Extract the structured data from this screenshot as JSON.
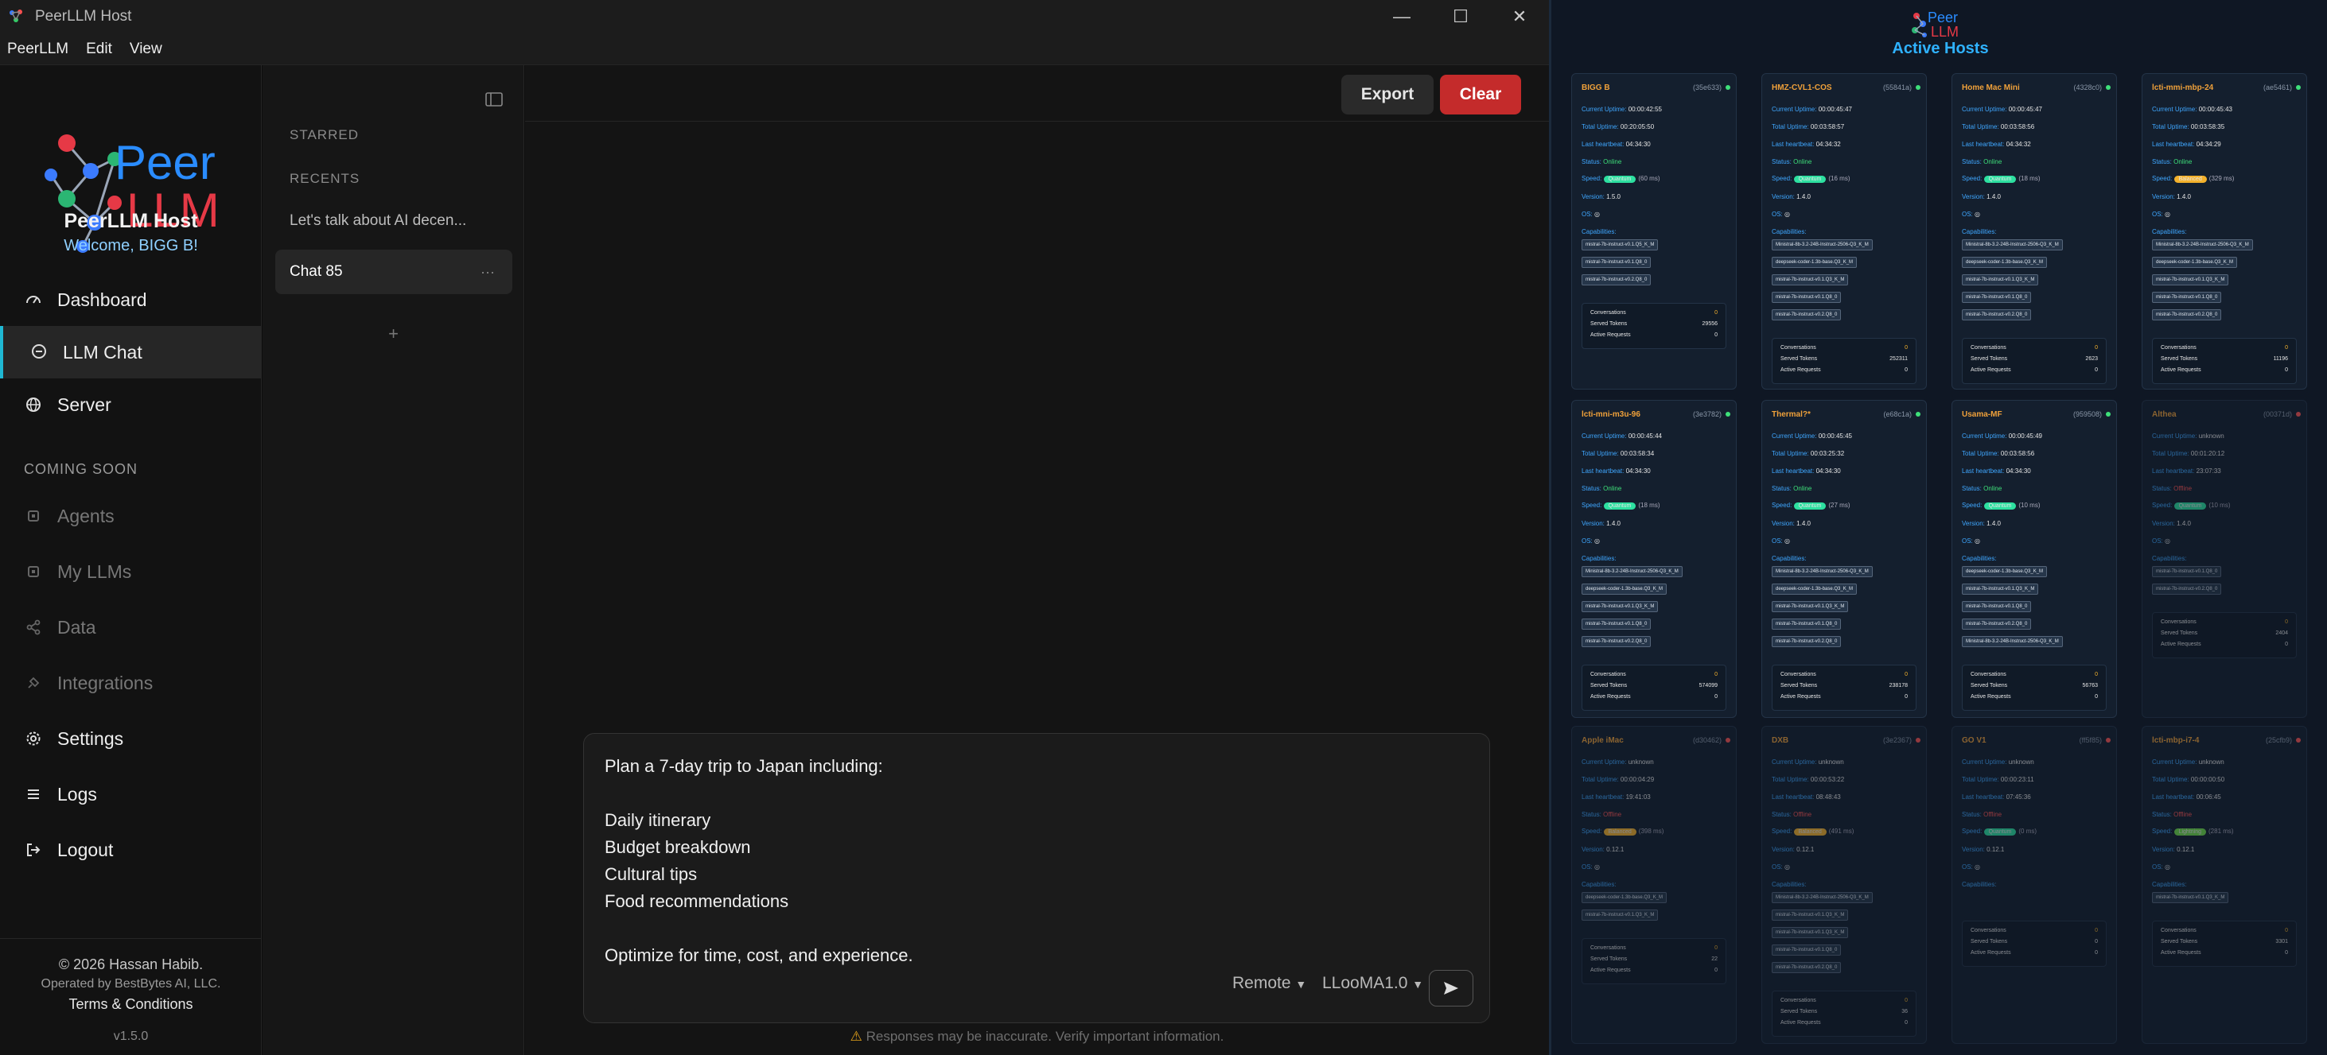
{
  "window": {
    "title": "PeerLLM Host",
    "controls": [
      "minimize",
      "maximize",
      "close"
    ]
  },
  "menu": [
    "PeerLLM",
    "Edit",
    "View"
  ],
  "sidebar": {
    "brand_name": "PeerLLM Host",
    "welcome": "Welcome, BIGG B!",
    "logo_text_top": "Peer",
    "logo_text_bottom": "LLM",
    "nav": [
      {
        "label": "Dashboard",
        "icon": "gauge-icon",
        "active": false,
        "disabled": false
      },
      {
        "label": "LLM Chat",
        "icon": "chat-icon",
        "active": true,
        "disabled": false
      },
      {
        "label": "Server",
        "icon": "globe-icon",
        "active": false,
        "disabled": false
      }
    ],
    "coming_soon_label": "COMING SOON",
    "coming_soon": [
      {
        "label": "Agents",
        "icon": "chip-icon"
      },
      {
        "label": "My LLMs",
        "icon": "chip-icon"
      },
      {
        "label": "Data",
        "icon": "share-icon"
      },
      {
        "label": "Integrations",
        "icon": "plug-icon"
      }
    ],
    "bottom_nav": [
      {
        "label": "Settings",
        "icon": "gear-icon"
      },
      {
        "label": "Logs",
        "icon": "list-icon"
      },
      {
        "label": "Logout",
        "icon": "logout-icon"
      }
    ],
    "footer": {
      "copyright": "© 2026 Hassan Habib.",
      "operated": "Operated by BestBytes AI, LLC.",
      "terms": "Terms & Conditions",
      "version": "v1.5.0"
    }
  },
  "chat_list": {
    "starred_label": "STARRED",
    "recents_label": "RECENTS",
    "items": [
      {
        "title": "Let's talk about AI decen...",
        "selected": false
      },
      {
        "title": "Chat 85",
        "selected": true,
        "more": "···"
      }
    ],
    "add_label": "+"
  },
  "main": {
    "export_label": "Export",
    "clear_label": "Clear",
    "prompt_lines": [
      "Plan a 7-day trip to Japan including:",
      "",
      "Daily itinerary",
      "Budget breakdown",
      "Cultural tips",
      "Food recommendations",
      "",
      "Optimize for time, cost, and experience."
    ],
    "mode_select": "Remote",
    "model_select": "LLooMA1.0",
    "disclaimer": "Responses may be inaccurate. Verify important information."
  },
  "hosts_panel": {
    "title": "Active Hosts",
    "labels": {
      "current": "Current Uptime:",
      "total": "Total Uptime:",
      "heartbeat": "Last heartbeat:",
      "status": "Status:",
      "speed": "Speed:",
      "version": "Version:",
      "os": "OS:",
      "capabilities": "Capabilities:",
      "conversations": "Conversations",
      "served": "Served Tokens",
      "active": "Active Requests"
    },
    "hosts": [
      {
        "name": "BIGG B",
        "id": "(35e633)",
        "online": true,
        "current": "00:00:42:55",
        "total": "00:20:05:50",
        "heartbeat": "04:34:30",
        "status": "Online",
        "speed": "Quantum",
        "latency": "(60 ms)",
        "version": "1.5.0",
        "caps": [
          "mistral-7b-instruct-v0.1.Q5_K_M",
          "mistral-7b-instruct-v0.1.Q8_0",
          "mistral-7b-instruct-v0.2.Q8_0"
        ],
        "conversations": "0",
        "served": "29556",
        "active_req": "0"
      },
      {
        "name": "HMZ-CVL1-COS",
        "id": "(55841a)",
        "online": true,
        "current": "00:00:45:47",
        "total": "00:03:58:57",
        "heartbeat": "04:34:32",
        "status": "Online",
        "speed": "Quantum",
        "latency": "(16 ms)",
        "version": "1.4.0",
        "caps": [
          "Ministral-8b-3.2-24B-Instruct-2506-Q3_K_M",
          "deepseek-coder-1.3b-base.Q3_K_M",
          "mistral-7b-instruct-v0.1.Q3_K_M",
          "mistral-7b-instruct-v0.1.Q8_0",
          "mistral-7b-instruct-v0.2.Q8_0"
        ],
        "conversations": "0",
        "served": "252311",
        "active_req": "0"
      },
      {
        "name": "Home Mac Mini",
        "id": "(4328c0)",
        "online": true,
        "current": "00:00:45:47",
        "total": "00:03:58:56",
        "heartbeat": "04:34:32",
        "status": "Online",
        "speed": "Quantum",
        "latency": "(18 ms)",
        "version": "1.4.0",
        "caps": [
          "Ministral-8b-3.2-24B-Instruct-2506-Q3_K_M",
          "deepseek-coder-1.3b-base.Q3_K_M",
          "mistral-7b-instruct-v0.1.Q3_K_M",
          "mistral-7b-instruct-v0.1.Q8_0",
          "mistral-7b-instruct-v0.2.Q8_0"
        ],
        "conversations": "0",
        "served": "2623",
        "active_req": "0"
      },
      {
        "name": "lcti-mmi-mbp-24",
        "id": "(ae5461)",
        "online": true,
        "current": "00:00:45:43",
        "total": "00:03:58:35",
        "heartbeat": "04:34:29",
        "status": "Online",
        "speed": "Balanced",
        "latency": "(329 ms)",
        "version": "1.4.0",
        "caps": [
          "Ministral-8b-3.2-24B-Instruct-2506-Q3_K_M",
          "deepseek-coder-1.3b-base.Q3_K_M",
          "mistral-7b-instruct-v0.1.Q3_K_M",
          "mistral-7b-instruct-v0.1.Q8_0",
          "mistral-7b-instruct-v0.2.Q8_0"
        ],
        "conversations": "0",
        "served": "11196",
        "active_req": "0"
      },
      {
        "name": "lcti-mni-m3u-96",
        "id": "(3e3782)",
        "online": true,
        "current": "00:00:45:44",
        "total": "00:03:58:34",
        "heartbeat": "04:34:30",
        "status": "Online",
        "speed": "Quantum",
        "latency": "(18 ms)",
        "version": "1.4.0",
        "caps": [
          "Ministral-8b-3.2-24B-Instruct-2506-Q3_K_M",
          "deepseek-coder-1.3b-base.Q3_K_M",
          "mistral-7b-instruct-v0.1.Q3_K_M",
          "mistral-7b-instruct-v0.1.Q8_0",
          "mistral-7b-instruct-v0.2.Q8_0"
        ],
        "conversations": "0",
        "served": "574099",
        "active_req": "0"
      },
      {
        "name": "Thermal?*",
        "id": "(e68c1a)",
        "online": true,
        "current": "00:00:45:45",
        "total": "00:03:25:32",
        "heartbeat": "04:34:30",
        "status": "Online",
        "speed": "Quantum",
        "latency": "(27 ms)",
        "version": "1.4.0",
        "caps": [
          "Ministral-8b-3.2-24B-Instruct-2506-Q3_K_M",
          "deepseek-coder-1.3b-base.Q3_K_M",
          "mistral-7b-instruct-v0.1.Q3_K_M",
          "mistral-7b-instruct-v0.1.Q8_0",
          "mistral-7b-instruct-v0.2.Q8_0"
        ],
        "conversations": "0",
        "served": "238178",
        "active_req": "0"
      },
      {
        "name": "Usama-MF",
        "id": "(959508)",
        "online": true,
        "current": "00:00:45:49",
        "total": "00:03:58:56",
        "heartbeat": "04:34:30",
        "status": "Online",
        "speed": "Quantum",
        "latency": "(10 ms)",
        "version": "1.4.0",
        "caps": [
          "deepseek-coder-1.3b-base.Q3_K_M",
          "mistral-7b-instruct-v0.1.Q3_K_M",
          "mistral-7b-instruct-v0.1.Q8_0",
          "mistral-7b-instruct-v0.2.Q8_0",
          "Ministral-8b-3.2-24B-Instruct-2506-Q3_K_M"
        ],
        "conversations": "0",
        "served": "56763",
        "active_req": "0"
      },
      {
        "name": "Althea",
        "id": "(00371d)",
        "online": false,
        "current": "unknown",
        "total": "00:01:20:12",
        "heartbeat": "23:07:33",
        "status": "Offline",
        "speed": "Quantum",
        "latency": "(10 ms)",
        "version": "1.4.0",
        "caps": [
          "mistral-7b-instruct-v0.1.Q8_0",
          "mistral-7b-instruct-v0.2.Q8_0"
        ],
        "conversations": "0",
        "served": "2404",
        "active_req": "0"
      },
      {
        "name": "Apple iMac",
        "id": "(d30462)",
        "online": false,
        "current": "unknown",
        "total": "00:00:04:29",
        "heartbeat": "19:41:03",
        "status": "Offline",
        "speed": "Balanced",
        "latency": "(398 ms)",
        "version": "0.12.1",
        "caps": [
          "deepseek-coder-1.3b-base.Q3_K_M",
          "mistral-7b-instruct-v0.1.Q3_K_M"
        ],
        "conversations": "0",
        "served": "22",
        "active_req": "0"
      },
      {
        "name": "DXB",
        "id": "(3e2367)",
        "online": false,
        "current": "unknown",
        "total": "00:00:53:22",
        "heartbeat": "08:48:43",
        "status": "Offline",
        "speed": "Balanced",
        "latency": "(491 ms)",
        "version": "0.12.1",
        "caps": [
          "Ministral-8b-3.2-24B-Instruct-2506-Q3_K_M",
          "mistral-7b-instruct-v0.1.Q3_K_M",
          "mistral-7b-instruct-v0.1.Q3_K_M",
          "mistral-7b-instruct-v0.1.Q8_0",
          "mistral-7b-instruct-v0.2.Q8_0"
        ],
        "conversations": "0",
        "served": "36",
        "active_req": "0"
      },
      {
        "name": "GO V1",
        "id": "(ff5f85)",
        "online": false,
        "current": "unknown",
        "total": "00:00:23:11",
        "heartbeat": "07:45:36",
        "status": "Offline",
        "speed": "Quantum",
        "latency": "(0 ms)",
        "version": "0.12.1",
        "caps": [],
        "conversations": "0",
        "served": "0",
        "active_req": "0"
      },
      {
        "name": "lcti-mbp-i7-4",
        "id": "(25cfb9)",
        "online": false,
        "current": "unknown",
        "total": "00:00:00:50",
        "heartbeat": "00:06:45",
        "status": "Offline",
        "speed": "Lightning",
        "latency": "(281 ms)",
        "version": "0.12.1",
        "caps": [
          "mistral-7b-instruct-v0.1.Q3_K_M"
        ],
        "conversations": "0",
        "served": "3301",
        "active_req": "0"
      }
    ]
  },
  "colors": {
    "accent": "#1fb8d3",
    "clear_button": "#c42b2b",
    "host_name": "#f0a13a",
    "host_label": "#3fa7ff",
    "online": "#3ee07a",
    "offline": "#ff5555",
    "quantum": "#2de0a0",
    "balanced": "#f3b12c",
    "lightning": "#6fdc4a"
  }
}
